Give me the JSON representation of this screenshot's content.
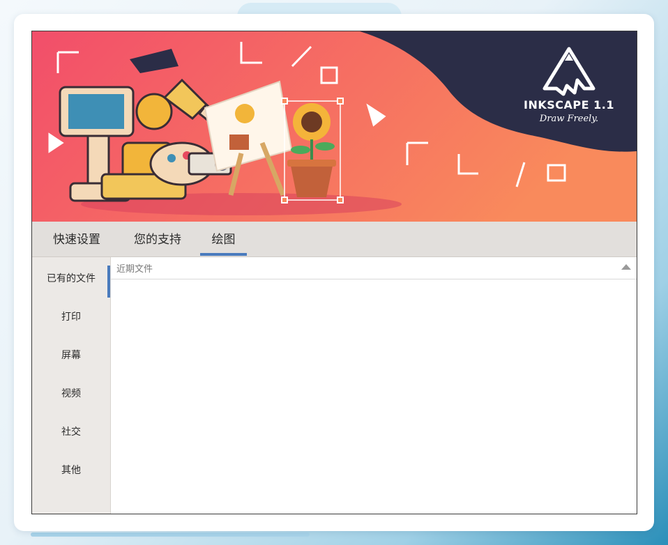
{
  "banner": {
    "logo_title": "INKSCAPE 1.1",
    "logo_tagline": "Draw Freely.",
    "gradient_colors": [
      "#f24e6a",
      "#f98a5c"
    ],
    "dark_color": "#2b2d47"
  },
  "tabs": [
    {
      "label": "快速设置"
    },
    {
      "label": "您的支持"
    },
    {
      "label": "绘图"
    }
  ],
  "active_tab": "绘图",
  "sidebar": {
    "items": [
      {
        "label": "已有的文件"
      },
      {
        "label": "打印"
      },
      {
        "label": "屏幕"
      },
      {
        "label": "视频"
      },
      {
        "label": "社交"
      },
      {
        "label": "其他"
      }
    ],
    "active": "已有的文件"
  },
  "content": {
    "section_title": "近期文件",
    "collapse_icon": "triangle-up-icon"
  },
  "accent_color": "#4a7bbd"
}
